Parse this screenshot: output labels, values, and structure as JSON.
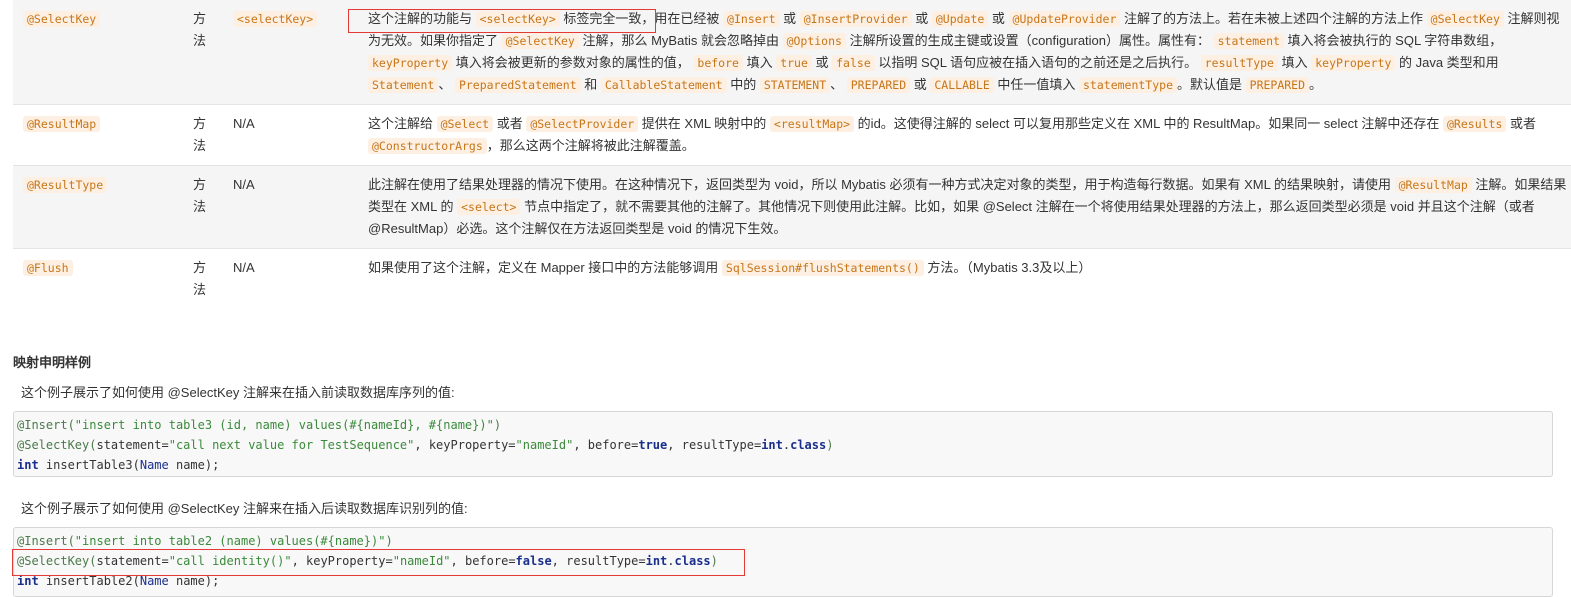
{
  "table": {
    "rows": [
      {
        "annotation": "@SelectKey",
        "target": "方法",
        "xml_equivalent": "<selectKey>",
        "description_parts": [
          {
            "t": "text",
            "v": "这个注解的功能与 "
          },
          {
            "t": "code",
            "v": "<selectKey>"
          },
          {
            "t": "text",
            "v": " 标签完全一致，"
          },
          {
            "t": "text",
            "v": "用在已经被 "
          },
          {
            "t": "code",
            "v": "@Insert"
          },
          {
            "t": "text",
            "v": " 或 "
          },
          {
            "t": "code",
            "v": "@InsertProvider"
          },
          {
            "t": "text",
            "v": " 或 "
          },
          {
            "t": "code",
            "v": "@Update"
          },
          {
            "t": "text",
            "v": " 或 "
          },
          {
            "t": "code",
            "v": "@UpdateProvider"
          },
          {
            "t": "text",
            "v": " 注解了的方法上。若在未被上述四个注解的方法上作 "
          },
          {
            "t": "code",
            "v": "@SelectKey"
          },
          {
            "t": "text",
            "v": " 注解则视为无效。如果你指定了 "
          },
          {
            "t": "code",
            "v": "@SelectKey"
          },
          {
            "t": "text",
            "v": " 注解，那么 MyBatis 就会忽略掉由 "
          },
          {
            "t": "code",
            "v": "@Options"
          },
          {
            "t": "text",
            "v": " 注解所设置的生成主键或设置（configuration）属性。属性有： "
          },
          {
            "t": "code",
            "v": "statement"
          },
          {
            "t": "text",
            "v": " 填入将会被执行的 SQL 字符串数组， "
          },
          {
            "t": "code",
            "v": "keyProperty"
          },
          {
            "t": "text",
            "v": " 填入将会被更新的参数对象的属性的值， "
          },
          {
            "t": "code",
            "v": "before"
          },
          {
            "t": "text",
            "v": " 填入 "
          },
          {
            "t": "code",
            "v": "true"
          },
          {
            "t": "text",
            "v": " 或 "
          },
          {
            "t": "code",
            "v": "false"
          },
          {
            "t": "text",
            "v": " 以指明 SQL 语句应被在插入语句的之前还是之后执行。 "
          },
          {
            "t": "code",
            "v": "resultType"
          },
          {
            "t": "text",
            "v": " 填入 "
          },
          {
            "t": "code",
            "v": "keyProperty"
          },
          {
            "t": "text",
            "v": " 的 Java 类型和用 "
          },
          {
            "t": "code",
            "v": "Statement"
          },
          {
            "t": "text",
            "v": "、 "
          },
          {
            "t": "code",
            "v": "PreparedStatement"
          },
          {
            "t": "text",
            "v": " 和 "
          },
          {
            "t": "code",
            "v": "CallableStatement"
          },
          {
            "t": "text",
            "v": " 中的 "
          },
          {
            "t": "code",
            "v": "STATEMENT"
          },
          {
            "t": "text",
            "v": "、 "
          },
          {
            "t": "code",
            "v": "PREPARED"
          },
          {
            "t": "text",
            "v": " 或 "
          },
          {
            "t": "code",
            "v": "CALLABLE"
          },
          {
            "t": "text",
            "v": " 中任一值填入 "
          },
          {
            "t": "code",
            "v": "statementType"
          },
          {
            "t": "text",
            "v": "。默认值是 "
          },
          {
            "t": "code",
            "v": "PREPARED"
          },
          {
            "t": "text",
            "v": "。"
          }
        ]
      },
      {
        "annotation": "@ResultMap",
        "target": "方法",
        "xml_equivalent": "N/A",
        "description_parts": [
          {
            "t": "text",
            "v": "这个注解给 "
          },
          {
            "t": "code",
            "v": "@Select"
          },
          {
            "t": "text",
            "v": " 或者 "
          },
          {
            "t": "code",
            "v": "@SelectProvider"
          },
          {
            "t": "text",
            "v": " 提供在 XML 映射中的 "
          },
          {
            "t": "code",
            "v": "<resultMap>"
          },
          {
            "t": "text",
            "v": " 的id。这使得注解的 select 可以复用那些定义在 XML 中的 ResultMap。如果同一 select 注解中还存在 "
          },
          {
            "t": "code",
            "v": "@Results"
          },
          {
            "t": "text",
            "v": " 或者 "
          },
          {
            "t": "code",
            "v": "@ConstructorArgs"
          },
          {
            "t": "text",
            "v": "，那么这两个注解将被此注解覆盖。"
          }
        ]
      },
      {
        "annotation": "@ResultType",
        "target": "方法",
        "xml_equivalent": "N/A",
        "description_parts": [
          {
            "t": "text",
            "v": "此注解在使用了结果处理器的情况下使用。在这种情况下，返回类型为 void，所以 Mybatis 必须有一种方式决定对象的类型，用于构造每行数据。如果有 XML 的结果映射，请使用 "
          },
          {
            "t": "code",
            "v": "@ResultMap"
          },
          {
            "t": "text",
            "v": " 注解。如果结果类型在 XML 的 "
          },
          {
            "t": "code",
            "v": "<select>"
          },
          {
            "t": "text",
            "v": " 节点中指定了，就不需要其他的注解了。其他情况下则使用此注解。比如，如果 @Select 注解在一个将使用结果处理器的方法上，那么返回类型必须是 void 并且这个注解（或者@ResultMap）必选。这个注解仅在方法返回类型是 void 的情况下生效。"
          }
        ]
      },
      {
        "annotation": "@Flush",
        "target": "方法",
        "xml_equivalent": "N/A",
        "description_parts": [
          {
            "t": "text",
            "v": "如果使用了这个注解，定义在 Mapper 接口中的方法能够调用 "
          },
          {
            "t": "code",
            "v": "SqlSession#flushStatements()"
          },
          {
            "t": "text",
            "v": " 方法。（Mybatis 3.3及以上）"
          }
        ]
      }
    ]
  },
  "section": {
    "title": "映射申明样例",
    "example1_desc": "这个例子展示了如何使用 @SelectKey 注解来在插入前读取数据库序列的值:",
    "example2_desc": "这个例子展示了如何使用 @SelectKey 注解来在插入后读取数据库识别列的值:"
  },
  "code1": [
    [
      {
        "c": "ann",
        "v": "@Insert("
      },
      {
        "c": "str",
        "v": "\"insert into table3 (id, name) values(#{nameId}, #{name})\""
      },
      {
        "c": "ann",
        "v": ")"
      }
    ],
    [
      {
        "c": "ann",
        "v": "@SelectKey("
      },
      {
        "c": "plain",
        "v": "statement="
      },
      {
        "c": "str",
        "v": "\"call next value for TestSequence\""
      },
      {
        "c": "plain",
        "v": ", keyProperty="
      },
      {
        "c": "str",
        "v": "\"nameId\""
      },
      {
        "c": "plain",
        "v": ", before="
      },
      {
        "c": "kw",
        "v": "true"
      },
      {
        "c": "plain",
        "v": ", resultType="
      },
      {
        "c": "kw",
        "v": "int"
      },
      {
        "c": "plain",
        "v": "."
      },
      {
        "c": "kw",
        "v": "class"
      },
      {
        "c": "ann",
        "v": ")"
      }
    ],
    [
      {
        "c": "kw",
        "v": "int"
      },
      {
        "c": "plain",
        "v": " insertTable3("
      },
      {
        "c": "type",
        "v": "Name"
      },
      {
        "c": "plain",
        "v": " name);"
      }
    ]
  ],
  "code2": [
    [
      {
        "c": "ann",
        "v": "@Insert("
      },
      {
        "c": "str",
        "v": "\"insert into table2 (name) values(#{name})\""
      },
      {
        "c": "ann",
        "v": ")"
      }
    ],
    [
      {
        "c": "ann",
        "v": "@SelectKey("
      },
      {
        "c": "plain",
        "v": "statement="
      },
      {
        "c": "str",
        "v": "\"call identity()\""
      },
      {
        "c": "plain",
        "v": ", keyProperty="
      },
      {
        "c": "str",
        "v": "\"nameId\""
      },
      {
        "c": "plain",
        "v": ", before="
      },
      {
        "c": "kw",
        "v": "false"
      },
      {
        "c": "plain",
        "v": ", resultType="
      },
      {
        "c": "kw",
        "v": "int"
      },
      {
        "c": "plain",
        "v": "."
      },
      {
        "c": "kw",
        "v": "class"
      },
      {
        "c": "ann",
        "v": ")"
      }
    ],
    [
      {
        "c": "kw",
        "v": "int"
      },
      {
        "c": "plain",
        "v": " insertTable2("
      },
      {
        "c": "type",
        "v": "Name"
      },
      {
        "c": "plain",
        "v": " name);"
      }
    ]
  ],
  "highlight_color": "#e53935"
}
